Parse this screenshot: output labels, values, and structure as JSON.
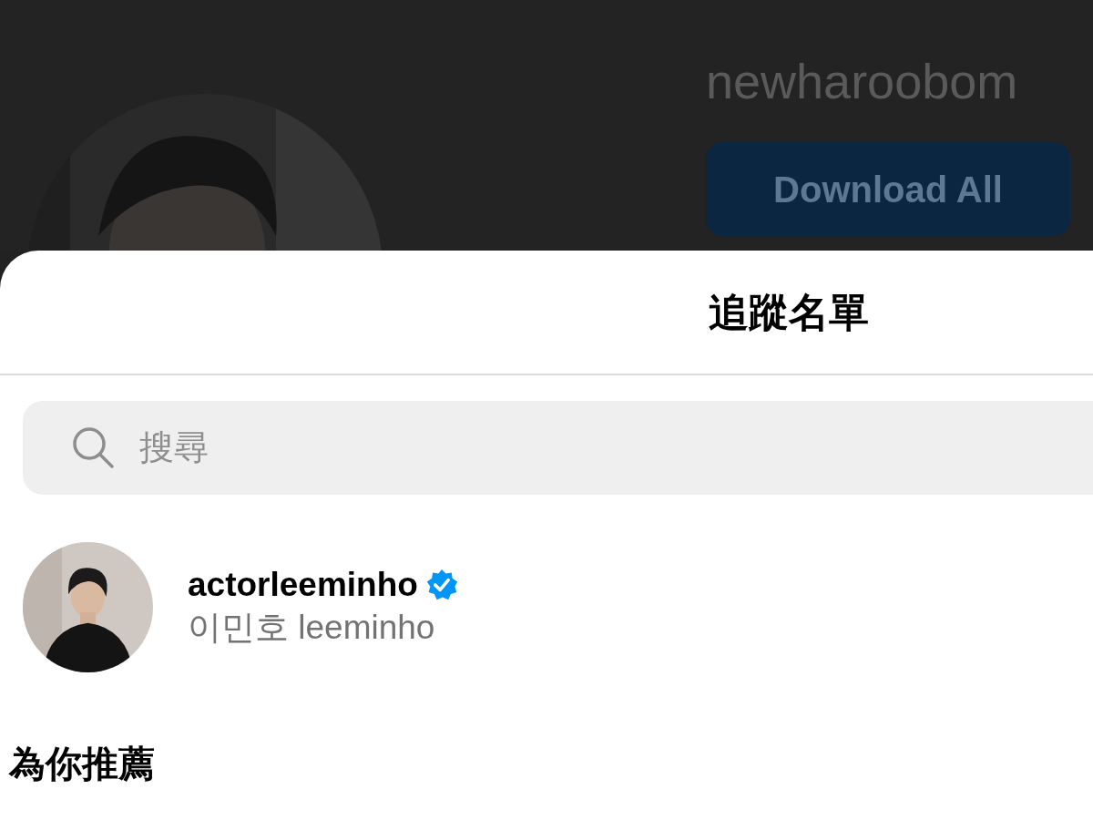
{
  "background_profile": {
    "username": "newharoobom",
    "download_button": "Download All"
  },
  "sheet": {
    "title": "追蹤名單",
    "search": {
      "placeholder": "搜尋"
    },
    "following": [
      {
        "username": "actorleeminho",
        "verified": true,
        "full_name": "이민호 leeminho"
      }
    ],
    "suggestions_heading": "為你推薦"
  }
}
